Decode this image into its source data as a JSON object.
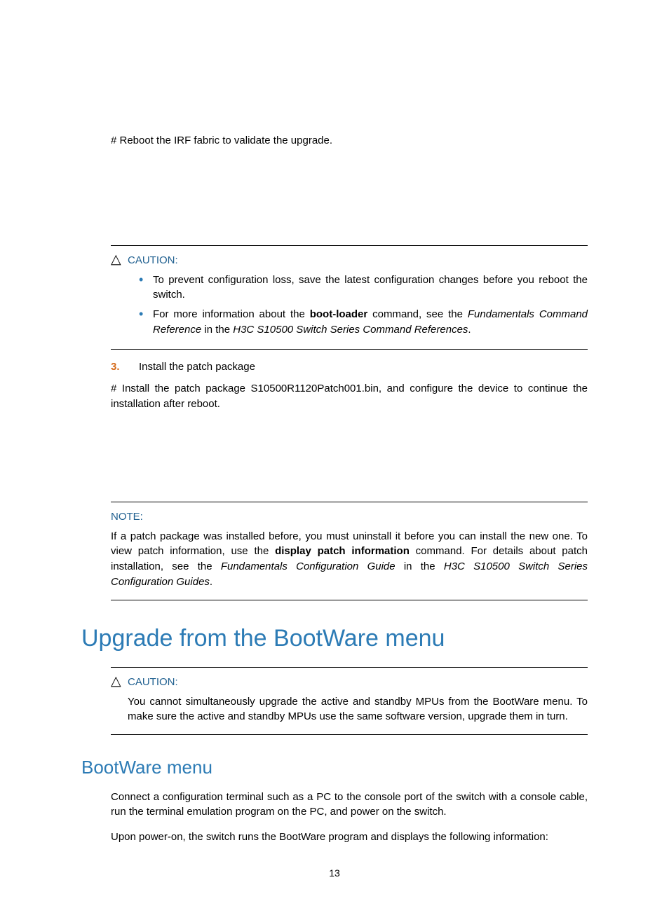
{
  "intro_line": "# Reboot the IRF fabric to validate the upgrade.",
  "caution1": {
    "label": "CAUTION:",
    "bullet1_text": "To prevent configuration loss, save the latest configuration changes before you reboot the switch.",
    "bullet2_prefix": "For more information about the ",
    "bullet2_bold": "boot-loader",
    "bullet2_mid": " command, see the ",
    "bullet2_it1": "Fundamentals Command Reference",
    "bullet2_mid2": " in the ",
    "bullet2_it2": "H3C S10500 Switch Series  Command References",
    "bullet2_end": "."
  },
  "step3": {
    "num": "3.",
    "title": "Install the patch package"
  },
  "step3_body": "# Install the patch package S10500R1120Patch001.bin, and configure the device to continue the installation after reboot.",
  "note": {
    "label": "NOTE:",
    "p_prefix": "If a patch package was installed before, you must uninstall it before you can install the new one. To view patch information, use the ",
    "p_bold": "display patch information",
    "p_mid": " command. For details about patch installation, see the ",
    "p_it1": "Fundamentals Configuration Guide",
    "p_mid2": " in the ",
    "p_it2": "H3C S10500 Switch Series Configuration Guides",
    "p_end": "."
  },
  "h1": "Upgrade from the BootWare menu",
  "caution2": {
    "label": "CAUTION:",
    "text": "You cannot simultaneously upgrade the active and standby MPUs from the BootWare menu. To make sure the active and standby MPUs use the same software version, upgrade them in turn."
  },
  "h2": "BootWare menu",
  "bw_p1": "Connect a configuration terminal such as a PC to the console port of the switch with a console cable, run the terminal emulation program on the PC, and power on the switch.",
  "bw_p2": "Upon power-on, the switch runs the BootWare program and displays the following information:",
  "page_num": "13"
}
